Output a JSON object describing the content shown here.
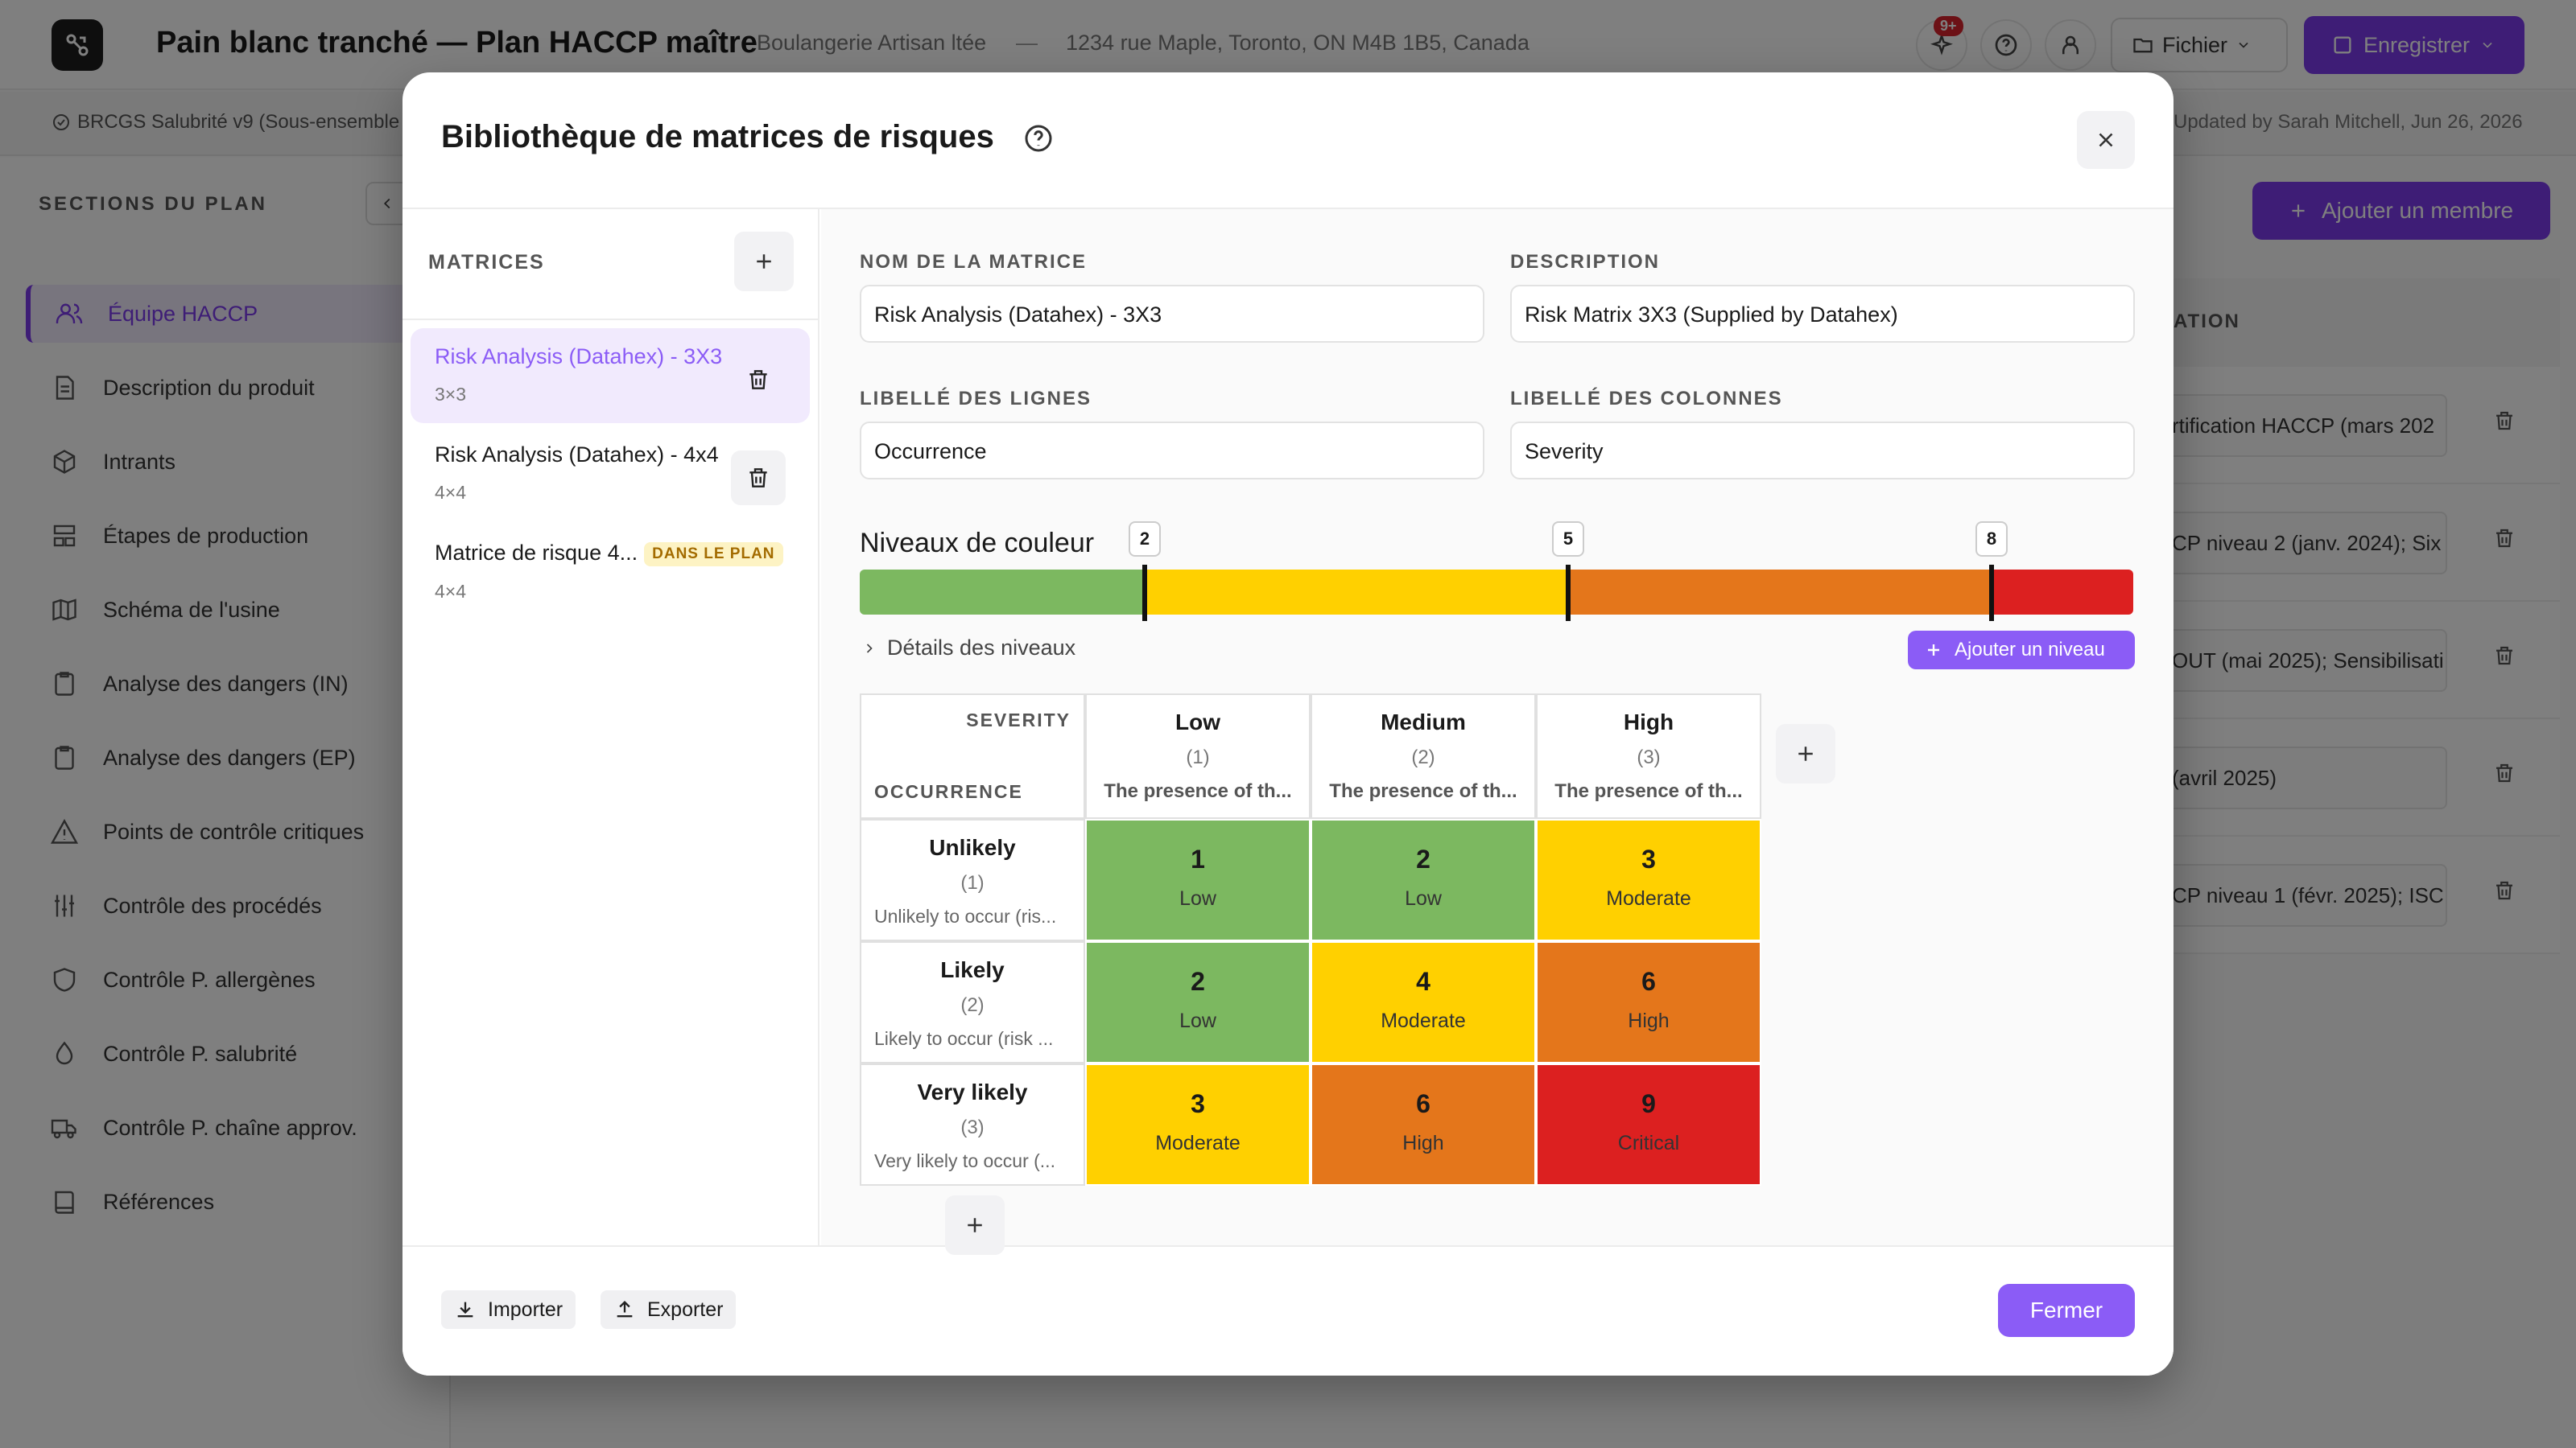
{
  "app": {
    "title": "Pain blanc tranché — Plan HACCP maître",
    "company": "Boulangerie Artisan ltée",
    "separator": "—",
    "address": "1234 rue Maple, Toronto, ON M4B 1B5, Canada",
    "notification_badge": "9+",
    "file_menu_label": "Fichier",
    "save_label": "Enregistrer",
    "standard": "BRCGS Salubrité v9 (Sous-ensemble",
    "updated": "Updated by Sarah Mitchell, Jun 26, 2026",
    "accent_color": "#7c3aed"
  },
  "sidebar": {
    "title": "SECTIONS DU PLAN",
    "items": [
      {
        "label": "Équipe HACCP",
        "icon": "users-icon",
        "active": true
      },
      {
        "label": "Description du produit",
        "icon": "document-icon"
      },
      {
        "label": "Intrants",
        "icon": "box-icon"
      },
      {
        "label": "Étapes de production",
        "icon": "steps-icon"
      },
      {
        "label": "Schéma de l'usine",
        "icon": "map-icon"
      },
      {
        "label": "Analyse des dangers (IN)",
        "icon": "clipboard-icon"
      },
      {
        "label": "Analyse des dangers (EP)",
        "icon": "clipboard-icon"
      },
      {
        "label": "Points de contrôle critiques",
        "icon": "warning-icon"
      },
      {
        "label": "Contrôle des procédés",
        "icon": "sliders-icon"
      },
      {
        "label": "Contrôle P. allergènes",
        "icon": "shield-icon"
      },
      {
        "label": "Contrôle P. salubrité",
        "icon": "drop-icon"
      },
      {
        "label": "Contrôle P. chaîne approv.",
        "icon": "truck-icon"
      },
      {
        "label": "Références",
        "icon": "book-icon"
      }
    ]
  },
  "background": {
    "add_member_label": "Ajouter un membre",
    "column_header": "ATION",
    "rows": [
      "rtification HACCP (mars 202",
      "CP niveau 2 (janv. 2024); Six",
      "OUT (mai 2025); Sensibilisati",
      "(avril 2025)",
      "CP niveau 1 (févr. 2025); ISC"
    ]
  },
  "modal": {
    "title": "Bibliothèque de matrices de risques",
    "matrices_title": "MATRICES",
    "matrices": [
      {
        "name": "Risk Analysis (Datahex) - 3X3",
        "size": "3×3",
        "selected": true
      },
      {
        "name": "Risk Analysis (Datahex) - 4x4",
        "size": "4×4"
      },
      {
        "name": "Matrice de risque 4...",
        "size": "4×4",
        "badge": "DANS LE PLAN"
      }
    ],
    "form": {
      "name_label": "NOM DE LA MATRICE",
      "name_value": "Risk Analysis (Datahex) - 3X3",
      "desc_label": "DESCRIPTION",
      "desc_value": "Risk Matrix 3X3 (Supplied by Datahex)",
      "row_label_label": "LIBELLÉ DES LIGNES",
      "row_label_value": "Occurrence",
      "col_label_label": "LIBELLÉ DES COLONNES",
      "col_label_value": "Severity"
    },
    "levels": {
      "title": "Niveaux de couleur",
      "thresholds": [
        "2",
        "5",
        "8"
      ],
      "colors": [
        "#7cb860",
        "#ffd000",
        "#e4761b",
        "#dc2020"
      ],
      "details_label": "Détails des niveaux",
      "add_level_label": "Ajouter un niveau"
    },
    "grid": {
      "col_axis": "SEVERITY",
      "row_axis": "OCCURRENCE",
      "columns": [
        {
          "name": "Low",
          "num": "(1)",
          "desc": "The presence of th..."
        },
        {
          "name": "Medium",
          "num": "(2)",
          "desc": "The presence of th..."
        },
        {
          "name": "High",
          "num": "(3)",
          "desc": "The presence of th..."
        }
      ],
      "rows": [
        {
          "name": "Unlikely",
          "num": "(1)",
          "desc": "Unlikely to occur (ris...",
          "cells": [
            {
              "v": "1",
              "l": "Low",
              "c": "#7cb860"
            },
            {
              "v": "2",
              "l": "Low",
              "c": "#7cb860"
            },
            {
              "v": "3",
              "l": "Moderate",
              "c": "#ffd000"
            }
          ]
        },
        {
          "name": "Likely",
          "num": "(2)",
          "desc": "Likely to occur (risk ...",
          "cells": [
            {
              "v": "2",
              "l": "Low",
              "c": "#7cb860"
            },
            {
              "v": "4",
              "l": "Moderate",
              "c": "#ffd000"
            },
            {
              "v": "6",
              "l": "High",
              "c": "#e4761b"
            }
          ]
        },
        {
          "name": "Very likely",
          "num": "(3)",
          "desc": "Very likely to occur (...",
          "cells": [
            {
              "v": "3",
              "l": "Moderate",
              "c": "#ffd000"
            },
            {
              "v": "6",
              "l": "High",
              "c": "#e4761b"
            },
            {
              "v": "9",
              "l": "Critical",
              "c": "#dc2020"
            }
          ]
        }
      ]
    },
    "footer": {
      "import_label": "Importer",
      "export_label": "Exporter",
      "close_label": "Fermer"
    }
  }
}
